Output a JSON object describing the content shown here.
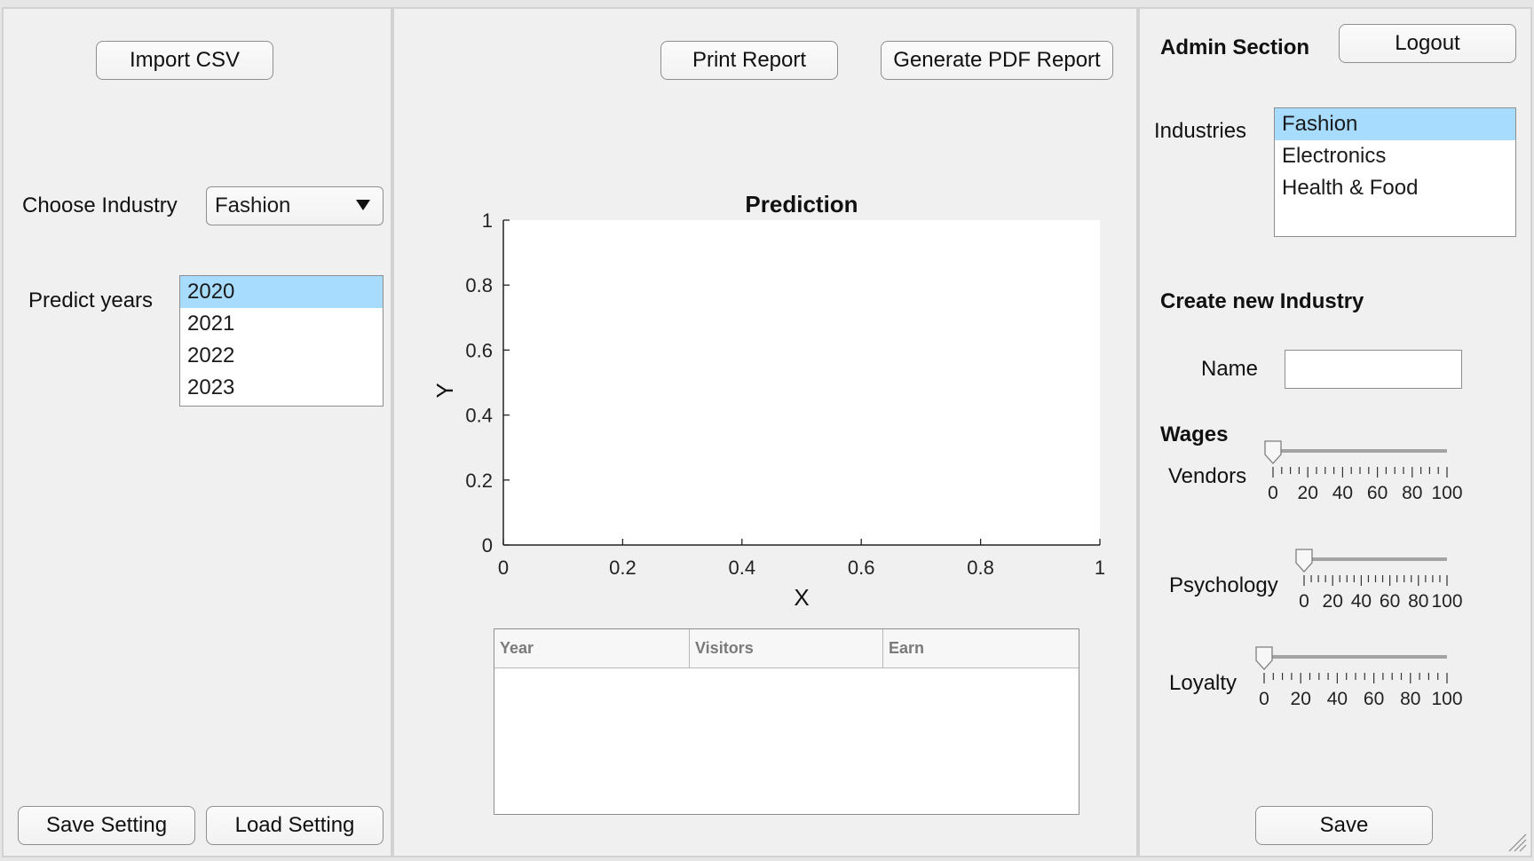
{
  "left": {
    "import_label": "Import CSV",
    "choose_industry_label": "Choose Industry",
    "industry_selected": "Fashion",
    "predict_years_label": "Predict years",
    "years": [
      "2020",
      "2021",
      "2022",
      "2023"
    ],
    "years_selected": "2020",
    "save_setting_label": "Save Setting",
    "load_setting_label": "Load Setting"
  },
  "middle": {
    "print_label": "Print Report",
    "pdf_label": "Generate PDF Report",
    "table_columns": [
      "Year",
      "Visitors",
      "Earn"
    ],
    "table_rows": []
  },
  "chart_data": {
    "type": "line",
    "title": "Prediction",
    "xlabel": "X",
    "ylabel": "Y",
    "xlim": [
      0,
      1
    ],
    "ylim": [
      0,
      1
    ],
    "xticks": [
      "0",
      "0.2",
      "0.4",
      "0.6",
      "0.8",
      "1"
    ],
    "yticks": [
      "0",
      "0.2",
      "0.4",
      "0.6",
      "0.8",
      "1"
    ],
    "series": [],
    "grid": false
  },
  "right": {
    "admin_title": "Admin Section",
    "logout_label": "Logout",
    "industries_label": "Industries",
    "industries": [
      "Fashion",
      "Electronics",
      "Health & Food"
    ],
    "industries_selected": "Fashion",
    "create_title": "Create new Industry",
    "name_label": "Name",
    "name_value": "",
    "wages_title": "Wages",
    "sliders": [
      {
        "label": "Vendors",
        "value": 0,
        "min": 0,
        "max": 100,
        "ticks": [
          "0",
          "20",
          "40",
          "60",
          "80",
          "100"
        ]
      },
      {
        "label": "Psychology",
        "value": 0,
        "min": 0,
        "max": 100,
        "ticks": [
          "0",
          "20",
          "40",
          "60",
          "80",
          "100"
        ]
      },
      {
        "label": "Loyalty",
        "value": 0,
        "min": 0,
        "max": 100,
        "ticks": [
          "0",
          "20",
          "40",
          "60",
          "80",
          "100"
        ]
      }
    ],
    "save_label": "Save"
  },
  "colors": {
    "panel_bg": "#f0f0f0",
    "selection": "#a8dcff",
    "border": "#8e8e8e"
  }
}
